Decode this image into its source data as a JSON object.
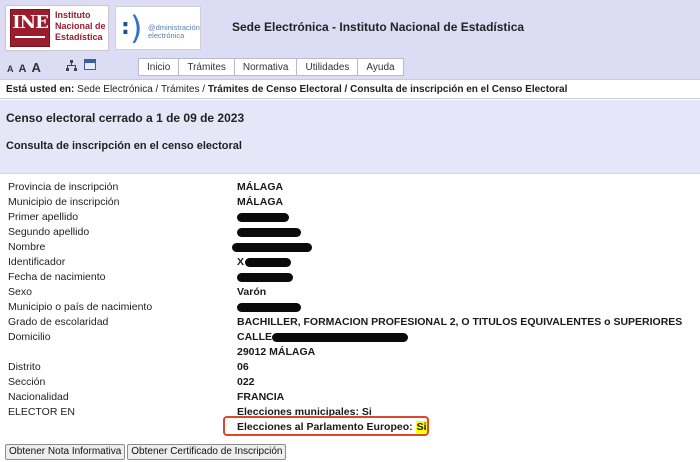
{
  "header": {
    "ine_logo": {
      "letters": "INE",
      "text_lines": [
        "Instituto",
        "Nacional de",
        "Estadística"
      ]
    },
    "ae_logo": {
      "text_lines": [
        "@dministración",
        "electrónica"
      ]
    },
    "site_title": "Sede Electrónica - Instituto Nacional de Estadística",
    "font_sizes": [
      "A",
      "A",
      "A"
    ],
    "icons": [
      "sitemap-icon",
      "accessibility-icon"
    ],
    "tabs": [
      {
        "label": "Inicio"
      },
      {
        "label": "Trámites"
      },
      {
        "label": "Normativa"
      },
      {
        "label": "Utilidades"
      },
      {
        "label": "Ayuda"
      }
    ]
  },
  "breadcrumb": {
    "prefix": "Está usted en",
    "items": [
      {
        "label": "Sede Electrónica"
      },
      {
        "label": "Trámites"
      },
      {
        "label": "Trámites de Censo Electoral"
      },
      {
        "label": "Consulta de inscripción en el Censo Electoral"
      }
    ]
  },
  "page": {
    "title": "Censo electoral cerrado a 1 de 09 de 2023",
    "subtitle": "Consulta de inscripción en el censo electoral"
  },
  "fields": {
    "provincia": {
      "label": "Provincia de inscripción",
      "value": "MÁLAGA"
    },
    "municipio": {
      "label": "Municipio de inscripción",
      "value": "MÁLAGA"
    },
    "primer_apellido": {
      "label": "Primer apellido"
    },
    "segundo_apellido": {
      "label": "Segundo apellido"
    },
    "nombre": {
      "label": "Nombre"
    },
    "identificador": {
      "label": "Identificador",
      "value": "X"
    },
    "fecha_nacimiento": {
      "label": "Fecha de nacimiento"
    },
    "sexo": {
      "label": "Sexo",
      "value": "Varón"
    },
    "municipio_nacimiento": {
      "label": "Municipio o país de nacimiento"
    },
    "escolaridad": {
      "label": "Grado de escolaridad",
      "value": "BACHILLER, FORMACION PROFESIONAL 2, O TITULOS EQUIVALENTES o SUPERIORES"
    },
    "domicilio": {
      "label": "Domicilio",
      "value": "CALLE",
      "value_line2": "29012 MÁLAGA"
    },
    "distrito": {
      "label": "Distrito",
      "value": "06"
    },
    "seccion": {
      "label": "Sección",
      "value": "022"
    },
    "nacionalidad": {
      "label": "Nacionalidad",
      "value": "FRANCIA"
    },
    "elector": {
      "label": "ELECTOR EN",
      "municipales_label": "Elecciones municipales:",
      "municipales_value": "Si",
      "europeas_label": "Elecciones al Parlamento Europeo:",
      "europeas_value": "Si"
    }
  },
  "buttons": {
    "nota": "Obtener Nota Informativa",
    "certificado": "Obtener Certificado de Inscripción"
  },
  "colors": {
    "header_bg": "#dcdcf4",
    "title_bg": "#e6e6f8",
    "ine_red": "#9b1c2c",
    "highlight_box": "#d94a2a",
    "highlight_text": "#ffff00"
  }
}
